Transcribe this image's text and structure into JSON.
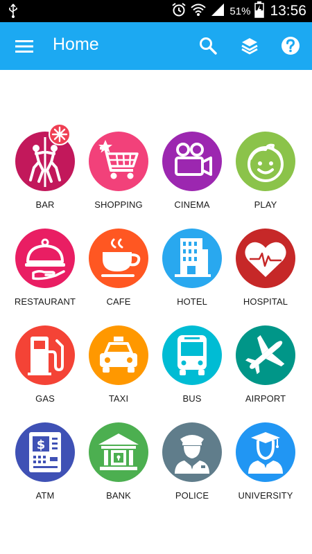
{
  "status_bar": {
    "battery_percent": "51%",
    "time": "13:56",
    "icons": [
      "usb-icon",
      "alarm-icon",
      "wifi-icon",
      "signal-icon",
      "battery-charging-icon"
    ]
  },
  "app_bar": {
    "title": "Home",
    "color": "#1ca9f2",
    "icons": [
      "menu-icon",
      "search-icon",
      "layers-icon",
      "help-icon"
    ]
  },
  "categories": [
    {
      "label": "BAR",
      "color": "#c2185b",
      "icon": "pole-dancers-icon",
      "badge": true
    },
    {
      "label": "SHOPPING",
      "color": "#f2417a",
      "icon": "shopping-cart-icon"
    },
    {
      "label": "CINEMA",
      "color": "#9c27b0",
      "icon": "movie-camera-icon"
    },
    {
      "label": "PLAY",
      "color": "#8bc34a",
      "icon": "smiley-kid-icon"
    },
    {
      "label": "RESTAURANT",
      "color": "#e91e63",
      "icon": "cloche-icon"
    },
    {
      "label": "CAFE",
      "color": "#ff5722",
      "icon": "coffee-cup-icon"
    },
    {
      "label": "HOTEL",
      "color": "#29a8ef",
      "icon": "hotel-building-icon"
    },
    {
      "label": "HOSPITAL",
      "color": "#c62828",
      "icon": "heartbeat-icon"
    },
    {
      "label": "GAS",
      "color": "#f44336",
      "icon": "gas-pump-icon"
    },
    {
      "label": "TAXI",
      "color": "#ff9800",
      "icon": "taxi-icon"
    },
    {
      "label": "BUS",
      "color": "#00bcd4",
      "icon": "bus-icon"
    },
    {
      "label": "AIRPORT",
      "color": "#009688",
      "icon": "airplane-icon"
    },
    {
      "label": "ATM",
      "color": "#3f51b5",
      "icon": "atm-machine-icon"
    },
    {
      "label": "BANK",
      "color": "#4caf50",
      "icon": "bank-building-icon"
    },
    {
      "label": "POLICE",
      "color": "#607d8b",
      "icon": "police-officer-icon"
    },
    {
      "label": "UNIVERSITY",
      "color": "#2196f3",
      "icon": "graduate-icon"
    }
  ]
}
